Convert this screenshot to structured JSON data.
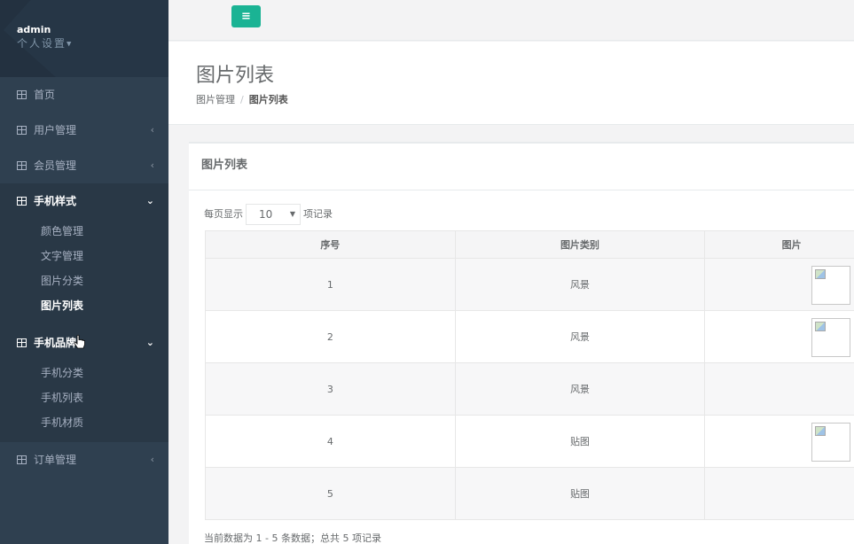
{
  "user": {
    "name": "admin",
    "settings": "个人设置"
  },
  "nav": {
    "home": "首页",
    "user_mgmt": "用户管理",
    "member_mgmt": "会员管理",
    "phone_style": {
      "label": "手机样式",
      "items": [
        "颜色管理",
        "文字管理",
        "图片分类",
        "图片列表"
      ]
    },
    "phone_brand": {
      "label": "手机品牌",
      "items": [
        "手机分类",
        "手机列表",
        "手机材质"
      ]
    },
    "order_mgmt": "订单管理"
  },
  "toolbar": {
    "menu_icon": "≡"
  },
  "page": {
    "title": "图片列表",
    "breadcrumb": [
      "图片管理",
      "图片列表"
    ]
  },
  "panel": {
    "title": "图片列表"
  },
  "length": {
    "prefix": "每页显示",
    "value": "10",
    "suffix": "项记录"
  },
  "table": {
    "headers": [
      "序号",
      "图片类别",
      "图片"
    ],
    "rows": [
      {
        "id": "1",
        "category": "风景",
        "has_image": true
      },
      {
        "id": "2",
        "category": "风景",
        "has_image": true
      },
      {
        "id": "3",
        "category": "风景",
        "has_image": false
      },
      {
        "id": "4",
        "category": "贴图",
        "has_image": true
      },
      {
        "id": "5",
        "category": "贴图",
        "has_image": false
      }
    ]
  },
  "info": "当前数据为 1 - 5 条数据；总共 5 项记录",
  "colors": {
    "sidebar": "#2f4050",
    "accent": "#1ab394"
  }
}
